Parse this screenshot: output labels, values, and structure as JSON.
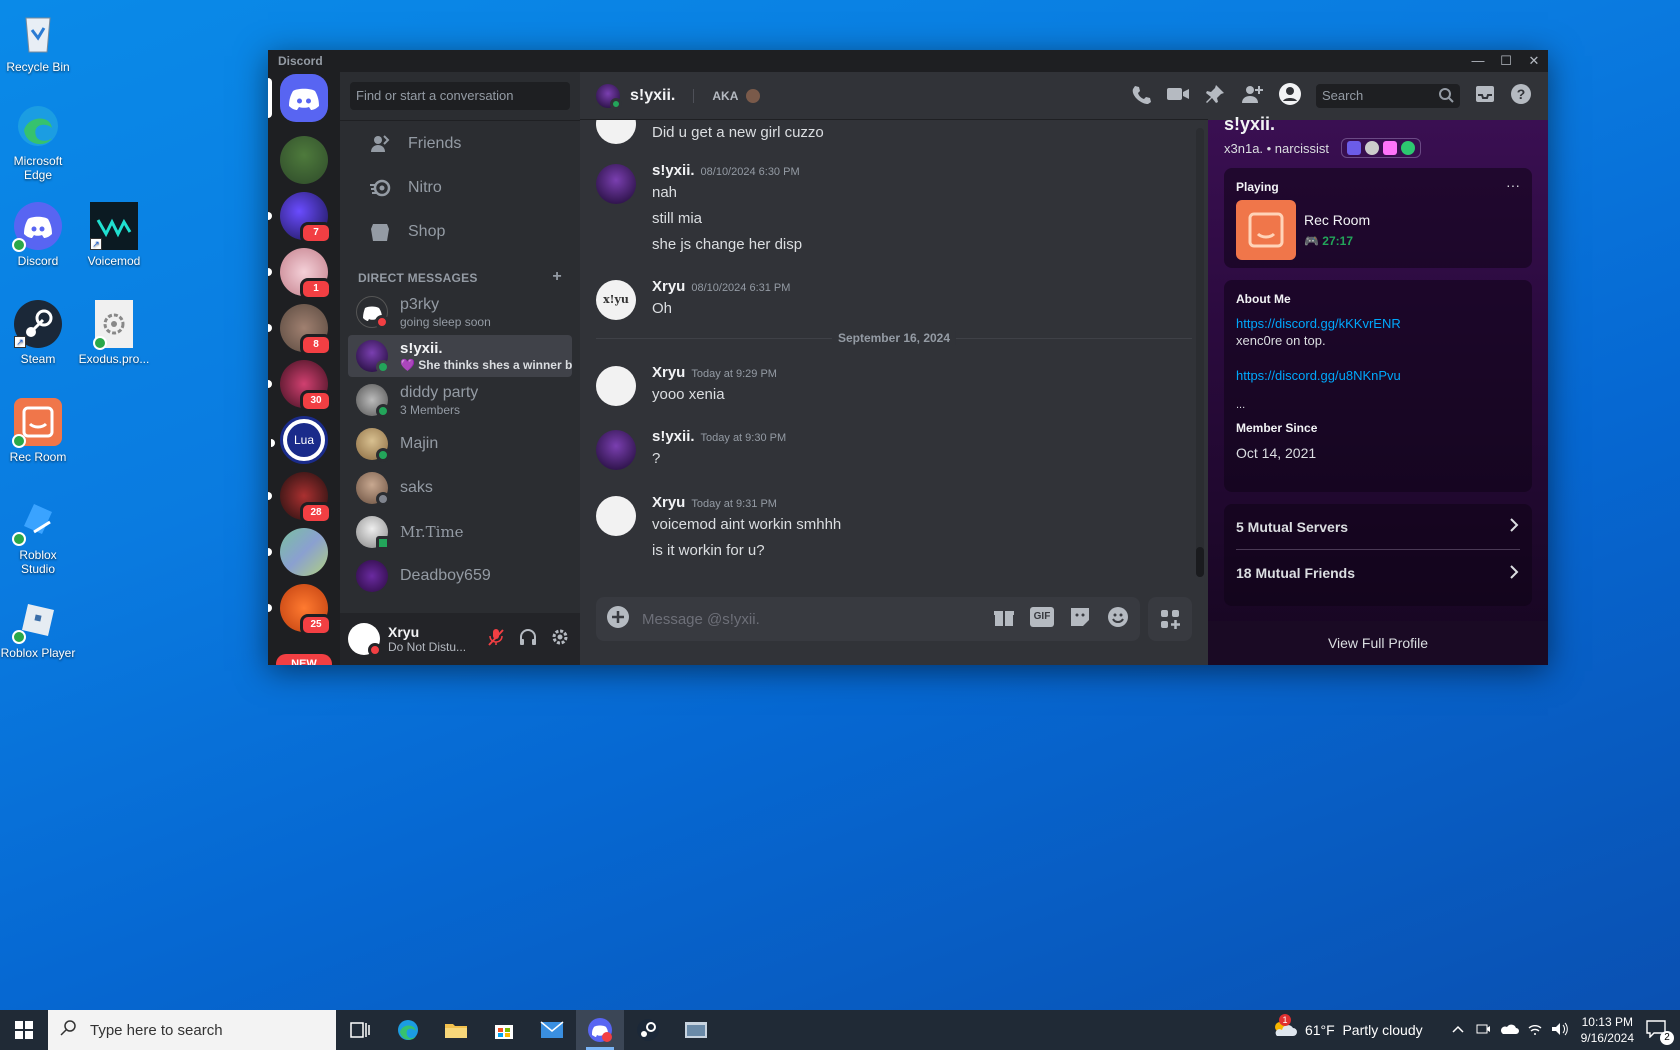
{
  "desktop": {
    "icons": [
      {
        "label": "Recycle Bin"
      },
      {
        "label": "Microsoft Edge"
      },
      {
        "label": "Discord"
      },
      {
        "label": "Voicemod"
      },
      {
        "label": "Steam"
      },
      {
        "label": "Exodus.pro..."
      },
      {
        "label": "Rec Room"
      },
      {
        "label": "Roblox Studio"
      },
      {
        "label": "Roblox Player"
      }
    ]
  },
  "window": {
    "title": "Discord",
    "minimize": "—",
    "maximize": "☐",
    "close": "✕"
  },
  "guilds": {
    "badges": [
      "7",
      "1",
      "8",
      "30",
      "28",
      "25"
    ],
    "new_label": "NEW",
    "lua_label": "Lua"
  },
  "dm_sidebar": {
    "search_placeholder": "Find or start a conversation",
    "nav": [
      {
        "label": "Friends"
      },
      {
        "label": "Nitro"
      },
      {
        "label": "Shop"
      }
    ],
    "section_title": "DIRECT MESSAGES",
    "add_symbol": "+",
    "dms": [
      {
        "name": "p3rky",
        "sub": "going sleep soon"
      },
      {
        "name": "s!yxii.",
        "sub": "💜 She thinks shes a winner b..."
      },
      {
        "name": "diddy party",
        "sub": "3 Members"
      },
      {
        "name": "Majin",
        "sub": ""
      },
      {
        "name": "saks",
        "sub": ""
      },
      {
        "name": "Mr.Time",
        "sub": ""
      },
      {
        "name": "Deadboy659",
        "sub": ""
      }
    ],
    "user": {
      "name": "Xryu",
      "status": "Do Not Distu..."
    }
  },
  "chat": {
    "header_name": "s!yxii.",
    "aka": "AKA",
    "search_placeholder": "Search",
    "messages": [
      {
        "author": "",
        "time": "",
        "lines": [
          "Did u get a new girl cuzzo"
        ]
      },
      {
        "author": "s!yxii.",
        "time": "08/10/2024 6:30 PM",
        "lines": [
          "nah",
          "still mia",
          "she js change her disp"
        ]
      },
      {
        "author": "Xryu",
        "time": "08/10/2024 6:31 PM",
        "lines": [
          "Oh"
        ]
      },
      {
        "author": "Xryu",
        "time": "Today at 9:29 PM",
        "lines": [
          "yooo xenia"
        ]
      },
      {
        "author": "s!yxii.",
        "time": "Today at 9:30 PM",
        "lines": [
          "?"
        ]
      },
      {
        "author": "Xryu",
        "time": "Today at 9:31 PM",
        "lines": [
          "voicemod aint workin smhhh",
          "is it workin for u?"
        ]
      }
    ],
    "date_divider": "September 16, 2024",
    "composer_placeholder": "Message @s!yxii.",
    "gif_label": "GIF"
  },
  "profile": {
    "name": "s!yxii.",
    "tag": "x3n1a. • narcissist",
    "playing_label": "Playing",
    "more": "···",
    "game": "Rec Room",
    "game_time": "27:17",
    "about_label": "About Me",
    "about_link1": "https://discord.gg/kKKvrENR",
    "about_text": "xenc0re on top.",
    "about_link2": "https://discord.gg/u8NKnPvu",
    "about_ellipsis": "...",
    "member_since_label": "Member Since",
    "member_since": "Oct 14, 2021",
    "mutual_servers": "5 Mutual Servers",
    "mutual_friends": "18 Mutual Friends",
    "view_full": "View Full Profile"
  },
  "taskbar": {
    "search_placeholder": "Type here to search",
    "weather": "61°F  Partly cloudy",
    "weather_badge": "1",
    "time": "10:13 PM",
    "date": "9/16/2024",
    "notif_count": "2"
  },
  "colors": {
    "discord_blurple": "#5865f2",
    "online": "#23a55a",
    "dnd": "#f23f43",
    "link": "#00a8fc"
  }
}
